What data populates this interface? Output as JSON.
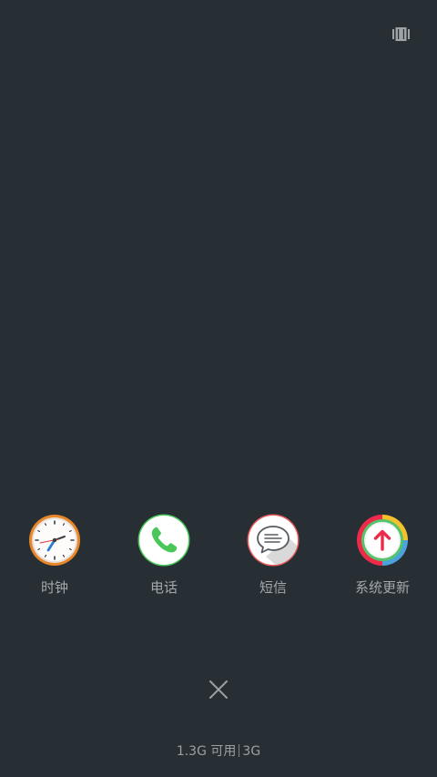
{
  "recent_apps": [
    {
      "name": "时钟",
      "icon": "clock-icon"
    },
    {
      "name": "电话",
      "icon": "phone-icon"
    },
    {
      "name": "短信",
      "icon": "message-icon"
    },
    {
      "name": "系统更新",
      "icon": "system-update-icon"
    }
  ],
  "memory": {
    "available": "1.3G 可用",
    "total": "3G"
  },
  "icons": {
    "top_right": "view-switch-icon",
    "close": "close-icon"
  },
  "colors": {
    "background": "#272f35",
    "label": "#a3a8ab",
    "clock_ring": "#e8862a",
    "phone_green": "#49c859",
    "message_ring": "#e65a5a",
    "update_red": "#ee2a4b"
  }
}
